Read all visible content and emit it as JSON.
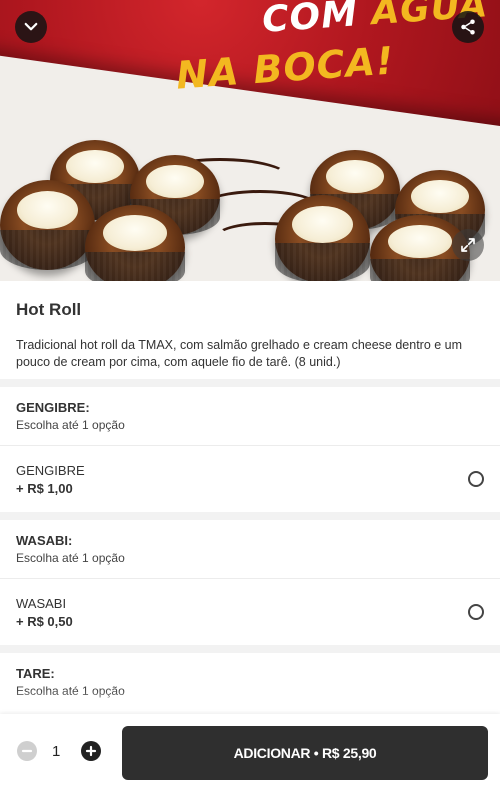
{
  "hero": {
    "line1_white": "COM ",
    "line1_yellow": "ÁGUA",
    "line2": "NA BOCA!",
    "icons": {
      "collapse": "chevron-down-icon",
      "share": "share-icon",
      "expand": "expand-icon"
    }
  },
  "product": {
    "name": "Hot Roll",
    "description": "Tradicional hot roll da TMAX, com salmão grelhado e cream cheese dentro e um pouco de cream por cima, com aquele fio de tarê. (8 unid.)"
  },
  "groups": [
    {
      "title": "GENGIBRE:",
      "subtitle": "Escolha até 1 opção",
      "options": [
        {
          "name": "GENGIBRE",
          "price": "+ R$ 1,00",
          "selected": false
        }
      ]
    },
    {
      "title": "WASABI:",
      "subtitle": "Escolha até 1 opção",
      "options": [
        {
          "name": "WASABI",
          "price": "+ R$ 0,50",
          "selected": false
        }
      ]
    },
    {
      "title": "TARE:",
      "subtitle": "Escolha até 1 opção",
      "options": []
    }
  ],
  "footer": {
    "quantity": "1",
    "add_label": "ADICIONAR • R$ 25,90"
  },
  "colors": {
    "hero_red": "#b0171f",
    "hero_yellow": "#f3b820",
    "button_dark": "#2f2f2f"
  }
}
